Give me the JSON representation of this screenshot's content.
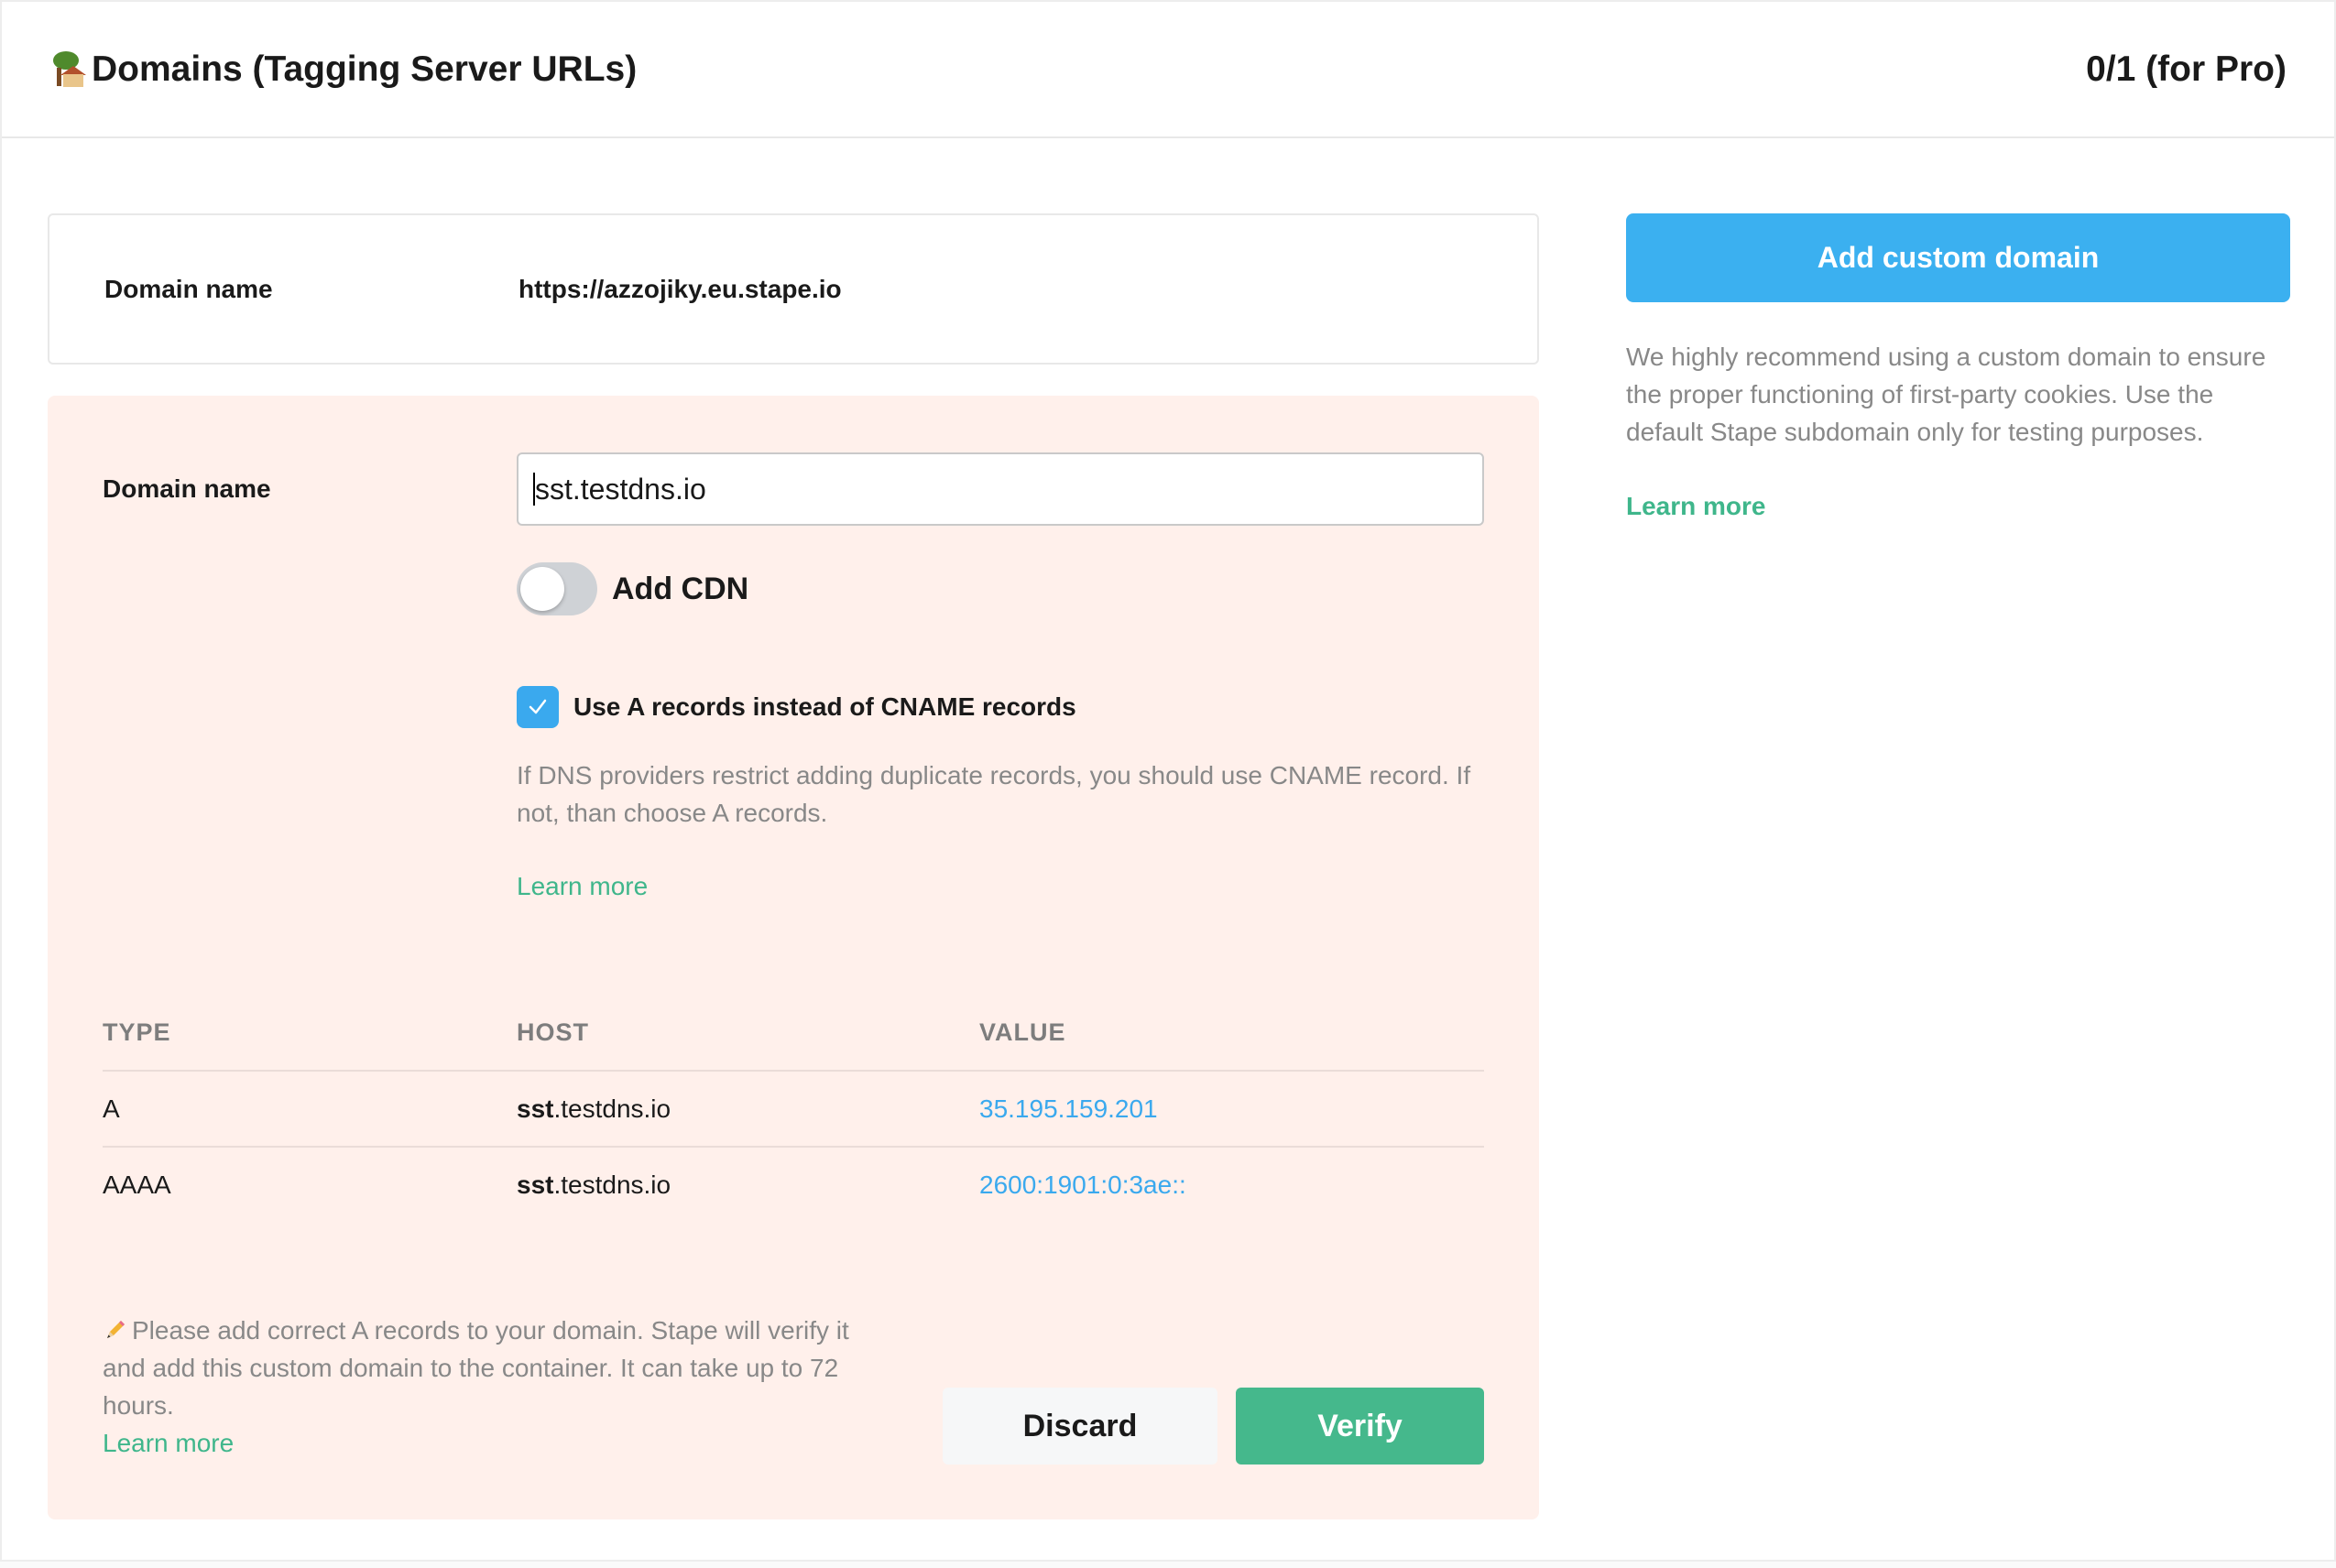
{
  "header": {
    "title": "Domains (Tagging Server URLs)",
    "title_icon": "house-with-tree-icon",
    "counter": "0/1 (for Pro)"
  },
  "current_domain": {
    "label": "Domain name",
    "value": "https://azzojiky.eu.stape.io"
  },
  "custom_domain_form": {
    "label": "Domain name",
    "input_value": "sst.testdns.io",
    "cdn_toggle": {
      "label": "Add CDN",
      "on": false
    },
    "a_records_checkbox": {
      "label": "Use A records instead of CNAME records",
      "checked": true
    },
    "help_text": "If DNS providers restrict adding duplicate records, you should use CNAME record. If not, than choose A records.",
    "learn_more": "Learn more",
    "table": {
      "headers": [
        "TYPE",
        "HOST",
        "VALUE"
      ],
      "rows": [
        {
          "type": "A",
          "host_bold": "sst",
          "host_rest": ".testdns.io",
          "value": "35.195.159.201"
        },
        {
          "type": "AAAA",
          "host_bold": "sst",
          "host_rest": ".testdns.io",
          "value": "2600:1901:0:3ae::"
        }
      ]
    },
    "note": "Please add correct A records to your domain. Stape will verify it and add this custom domain to the container. It can take up to 72 hours.",
    "note_learn_more": "Learn more",
    "discard_label": "Discard",
    "verify_label": "Verify"
  },
  "sidebar": {
    "add_button": "Add custom domain",
    "recommendation": "We highly recommend using a custom domain to ensure the proper functioning of first-party cookies. Use the default Stape subdomain only for testing purposes.",
    "learn_more": "Learn more"
  },
  "colors": {
    "primary_blue": "#3bb0f0",
    "verify_green": "#45b88c",
    "link_green": "#3fb68b",
    "panel_pink": "#fff0eb"
  }
}
